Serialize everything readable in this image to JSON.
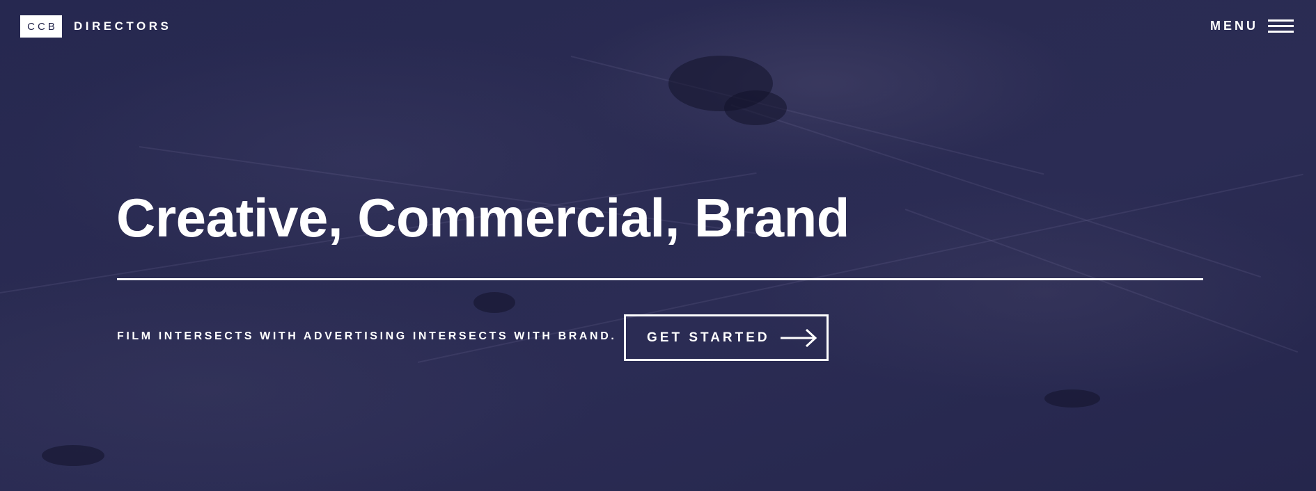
{
  "header": {
    "logo_mark": "CCB",
    "logo_text": "DIRECTORS",
    "menu_label": "MENU",
    "menu_icon": "hamburger-icon"
  },
  "hero": {
    "title": "Creative, Commercial, Brand",
    "tagline": "FILM INTERSECTS WITH ADVERTISING INTERSECTS WITH BRAND.",
    "cta_label": "GET STARTED",
    "cta_icon": "arrow-right-icon"
  },
  "colors": {
    "background_overlay": "#22244a",
    "text": "#ffffff",
    "logo_box": "#ffffff"
  }
}
